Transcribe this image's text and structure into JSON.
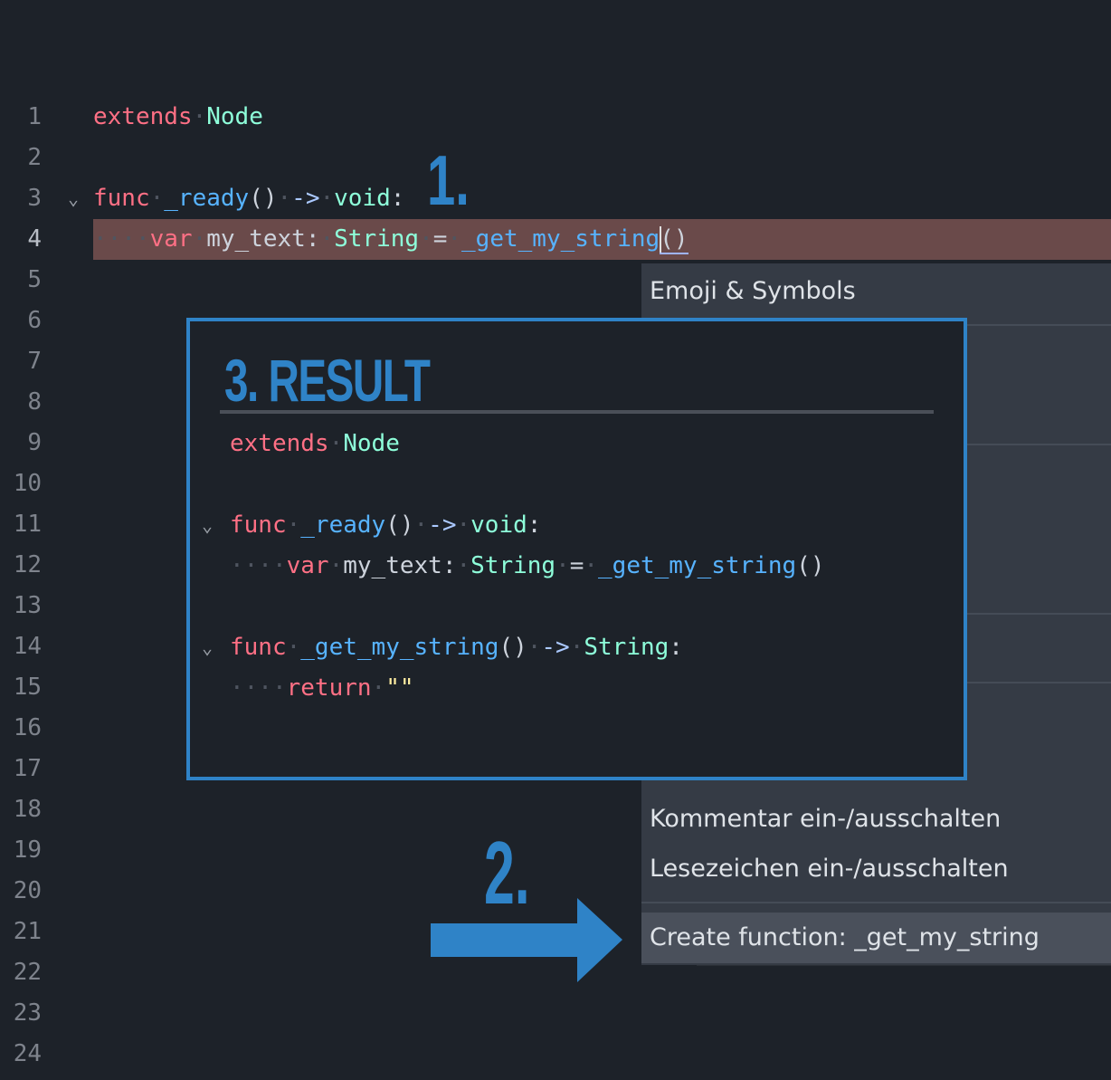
{
  "editor": {
    "line_numbers": [
      "1",
      "2",
      "3",
      "4",
      "5",
      "6",
      "7",
      "8",
      "9",
      "10",
      "11",
      "12",
      "13",
      "14",
      "15",
      "16",
      "17",
      "18",
      "19",
      "20",
      "21",
      "22",
      "23",
      "24"
    ],
    "line1": {
      "kw": "extends",
      "type": "Node"
    },
    "line3": {
      "kw": "func",
      "name": "_ready",
      "parens": "()",
      "arrow": "->",
      "ret": "void",
      "colon": ":"
    },
    "line4": {
      "kw": "var",
      "name": "my_text",
      "colon": ":",
      "type": "String",
      "eq": "=",
      "call_name": "_get_my_string",
      "parens": "()"
    }
  },
  "context_menu": {
    "items": [
      "Emoji & Symbols",
      "Kommentar ein-/ausschalten",
      "Lesezeichen ein-/ausschalten",
      "Create function: _get_my_string"
    ]
  },
  "result": {
    "title": "3. RESULT",
    "line1": {
      "kw": "extends",
      "type": "Node"
    },
    "line3": {
      "kw": "func",
      "name": "_ready",
      "parens": "()",
      "arrow": "->",
      "ret": "void",
      "colon": ":"
    },
    "line4": {
      "kw": "var",
      "name": "my_text",
      "colon": ":",
      "type": "String",
      "eq": "=",
      "call": "_get_my_string",
      "parens": "()"
    },
    "line6": {
      "kw": "func",
      "name": "_get_my_string",
      "parens": "()",
      "arrow": "->",
      "ret": "String",
      "colon": ":"
    },
    "line7": {
      "kw": "return",
      "str": "\"\""
    }
  },
  "annotations": {
    "step1": "1.",
    "step2": "2."
  },
  "colors": {
    "accent": "#2f83c7",
    "current_line": "#6a4a4a",
    "menu_bg": "#353b45",
    "background": "#1d2229"
  }
}
